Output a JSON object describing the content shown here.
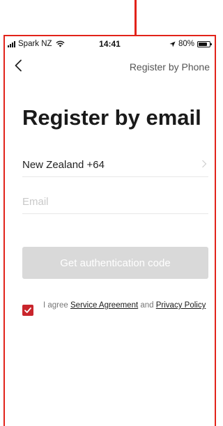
{
  "status_bar": {
    "carrier": "Spark NZ",
    "time": "14:41",
    "battery_percent": "80%",
    "battery_level": 0.8,
    "icons": [
      "signal-bars-icon",
      "wifi-icon",
      "location-arrow-icon",
      "battery-icon"
    ]
  },
  "nav": {
    "back_icon": "chevron-left-icon",
    "switch_link": "Register by Phone"
  },
  "page": {
    "title": "Register by email"
  },
  "form": {
    "country_value": "New Zealand +64",
    "country_icon": "chevron-right-icon",
    "email_value": "",
    "email_placeholder": "Email",
    "submit_label": "Get authentication code"
  },
  "agreement": {
    "checked": true,
    "prefix": "I agree ",
    "service_link": "Service Agreement",
    "conjunction": " and ",
    "privacy_link": "Privacy Policy"
  },
  "colors": {
    "annotation": "#e2231a",
    "accent": "#c9252c",
    "button_disabled": "#d9d9d9"
  }
}
